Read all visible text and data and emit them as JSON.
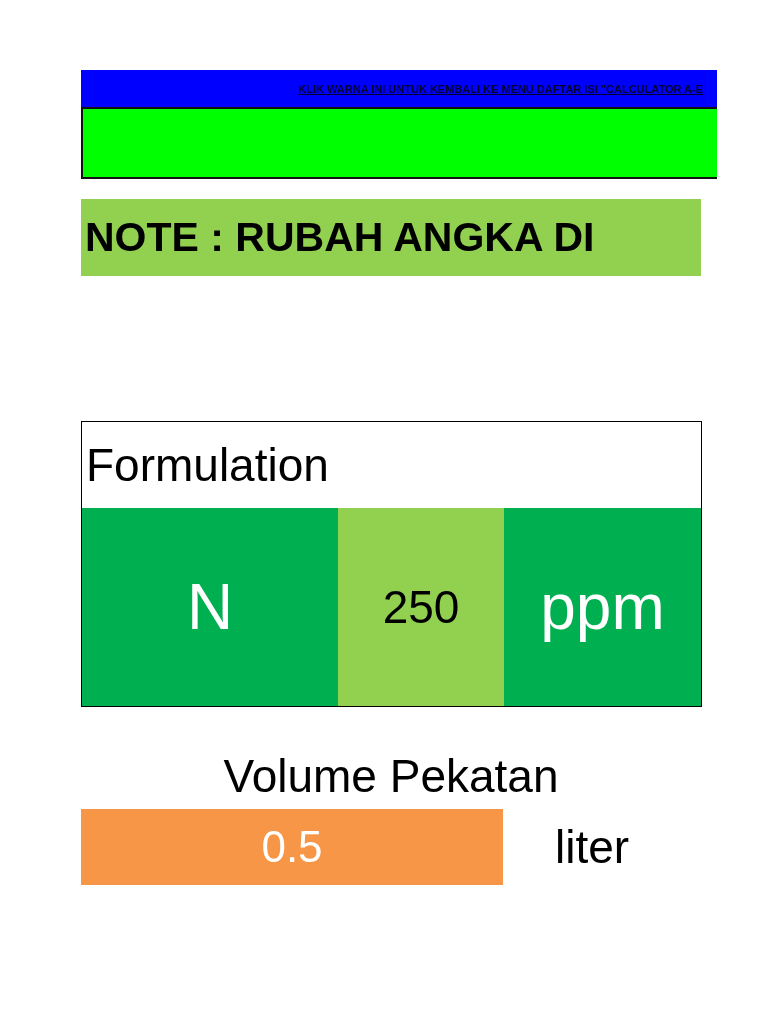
{
  "menu_link": {
    "label": "KLIK WARNA INI UNTUK KEMBALI KE MENU DAFTAR ISI \"CALCULATOR A-E"
  },
  "note": {
    "text": "NOTE : RUBAH ANGKA DI"
  },
  "formulation": {
    "title": "Formulation",
    "element": "N",
    "amount": "250",
    "unit": "ppm"
  },
  "volume": {
    "label": "Volume Pekatan",
    "value": "0.5",
    "unit": "liter"
  }
}
